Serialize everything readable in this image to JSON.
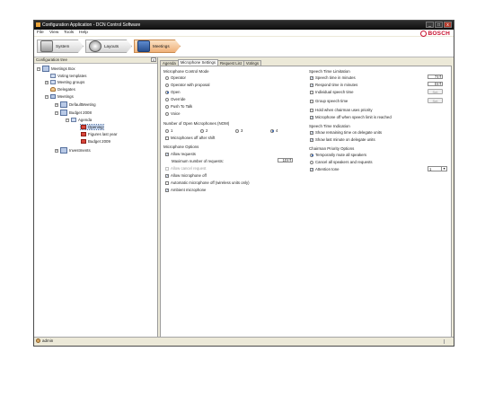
{
  "window": {
    "title": "Configuration Application - DCN Control Software",
    "buttons": [
      "_",
      "□",
      "x"
    ]
  },
  "menu": [
    "File",
    "View",
    "Tools",
    "Help"
  ],
  "brand": "BOSCH",
  "nav": {
    "system": "System",
    "layouts": "Layouts",
    "meetings": "Meetings"
  },
  "tree": {
    "header": "Configuration tree",
    "close": "x",
    "nodes": [
      "Meetings Box",
      "Voting templates",
      "Meeting groups",
      "Delegates",
      "Meetings",
      "DefaultMeeting",
      "Budget 2008",
      "Agenda",
      "Opening",
      "Figures last year",
      "Budget 2009",
      "Investments"
    ]
  },
  "tabs": [
    "Agenda",
    "Microphone Settings",
    "Request List",
    "Votings"
  ],
  "mic_control": {
    "title": "Microphone Control Mode",
    "options": [
      "Operator",
      "Operator with proposal",
      "Open",
      "Override",
      "Push To Talk",
      "Voice"
    ],
    "selected": "Open"
  },
  "open_mics": {
    "title": "Number of Open Microphones (NOM)",
    "options": [
      "1",
      "2",
      "3",
      "4"
    ],
    "selected": "4",
    "mics_off_label": "Microphones off after shift"
  },
  "mic_options": {
    "title": "Microphone Options",
    "allow_requests": "Allow requests",
    "max_requests_label": "Maximum number of requests:",
    "max_requests_value": "10",
    "allow_cancel": "Allow cancel request",
    "allow_mic_off": "Allow microphone off",
    "auto_mic_off": "Automatic microphone off (wireless units only)",
    "ambient": "Ambient microphone"
  },
  "speech_time": {
    "title": "Speech Time Limitation",
    "speech_time": "Speech time in minutes",
    "speech_value": "7",
    "respond_time": "Respond time in minutes",
    "respond_value": "0",
    "individual": "Individual speech time",
    "group": "Group speech time",
    "set_label": "Set",
    "hold": "Hold when chairman uses priority",
    "mic_off": "Microphone off when speech limit is reached"
  },
  "speech_indication": {
    "title": "Speech Time Indication",
    "remaining": "Show remaining time on delegate units",
    "last_minute": "Show last minute on delegate units"
  },
  "chairman": {
    "title": "Chairman Priority Options",
    "mute": "Temporarily mute all speakers",
    "cancel": "Cancel all speakers and requests",
    "attention": "Attention tone",
    "tone_value": "1"
  },
  "status": {
    "user": "admin"
  }
}
